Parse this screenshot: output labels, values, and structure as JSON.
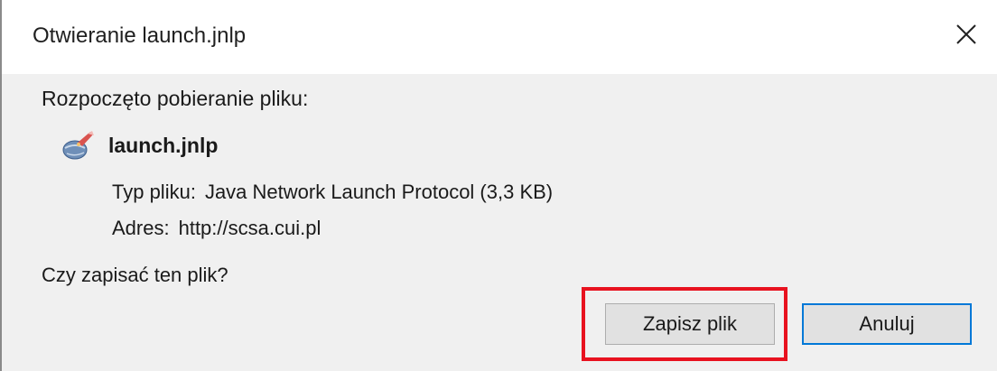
{
  "window": {
    "title": "Otwieranie launch.jnlp",
    "close_icon": "close-x-icon"
  },
  "download": {
    "started_text": "Rozpoczęto pobieranie pliku:",
    "file_icon": "java-web-start-icon",
    "file_name": "launch.jnlp",
    "type_label": "Typ pliku:",
    "type_value": "Java Network Launch Protocol (3,3 KB)",
    "address_label": "Adres:",
    "address_value": "http://scsa.cui.pl"
  },
  "prompt": {
    "question": "Czy zapisać ten plik?"
  },
  "buttons": {
    "save_label": "Zapisz plik",
    "cancel_label": "Anuluj"
  },
  "colors": {
    "highlight": "#e8121f",
    "default_button_border": "#0078d7",
    "dialog_body": "#f0f0f0"
  }
}
